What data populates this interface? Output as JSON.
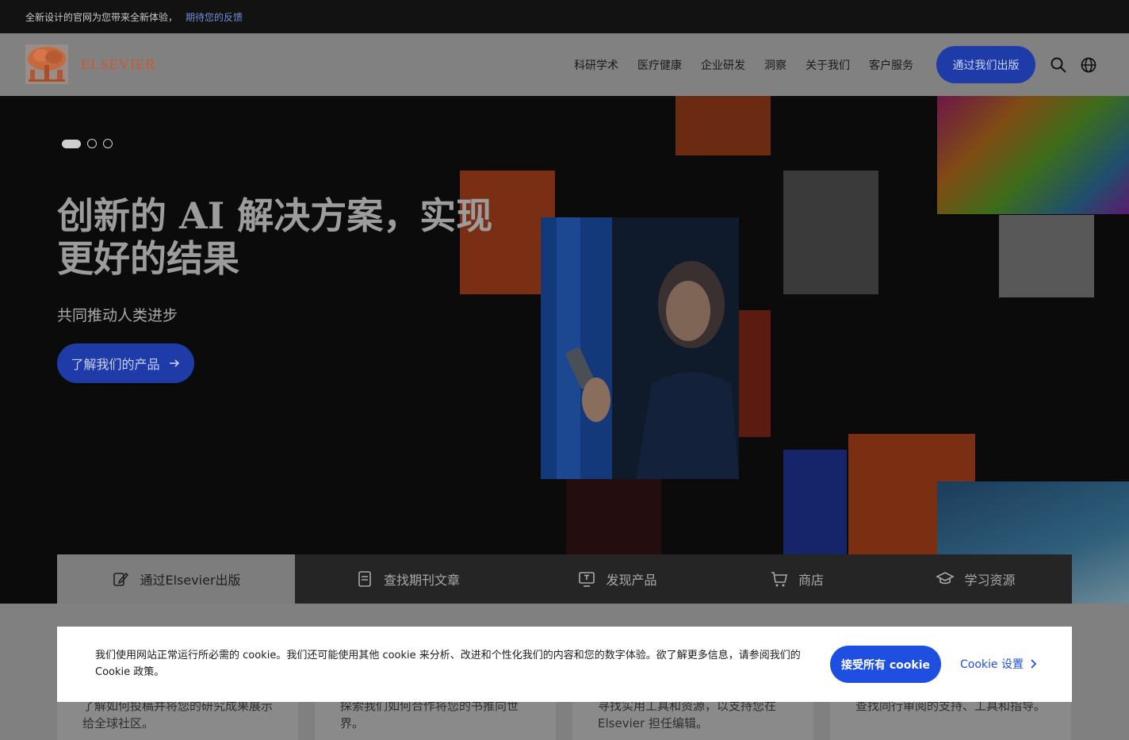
{
  "announcement": {
    "text": "全新设计的官网为您带来全新体验，",
    "link": "期待您的反馈"
  },
  "header": {
    "logo_text": "ELSEVIER",
    "nav": [
      "科研学术",
      "医疗健康",
      "企业研发",
      "洞察",
      "关于我们",
      "客户服务"
    ],
    "cta": "通过我们出版",
    "icons": [
      "search-icon",
      "globe-icon"
    ]
  },
  "hero": {
    "title": "创新的 AI 解决方案，实现更好的结果",
    "subtitle": "共同推动人类进步",
    "button": "了解我们的产品",
    "carousel": {
      "total": 3,
      "active": 1
    }
  },
  "tabs": [
    {
      "label": "通过Elsevier出版",
      "icon": "edit-document-icon",
      "active": true
    },
    {
      "label": "查找期刊文章",
      "icon": "document-icon",
      "active": false
    },
    {
      "label": "发现产品",
      "icon": "monitor-icon",
      "active": false
    },
    {
      "label": "商店",
      "icon": "cart-icon",
      "active": false
    },
    {
      "label": "学习资源",
      "icon": "graduation-cap-icon",
      "active": false
    }
  ],
  "cards": [
    {
      "text": "了解如何投稿并将您的研究成果展示给全球社区。"
    },
    {
      "text": "探索我们如何合作将您的书推向世界。"
    },
    {
      "text": "寻找实用工具和资源，以支持您在 Elsevier 担任编辑。"
    },
    {
      "text": "查找同行审阅的支持、工具和指导。"
    }
  ],
  "cookie": {
    "text": "我们使用网站正常运行所必需的 cookie。我们还可能使用其他 cookie 来分析、改进和个性化我们的内容和您的数字体验。欲了解更多信息，请参阅我们的 Cookie 政策。",
    "accept": "接受所有 cookie",
    "settings": "Cookie 设置"
  },
  "colors": {
    "brand_orange": "#d1562c",
    "primary_blue": "#1f4fe0",
    "dark_blue": "#1e3ba8"
  }
}
